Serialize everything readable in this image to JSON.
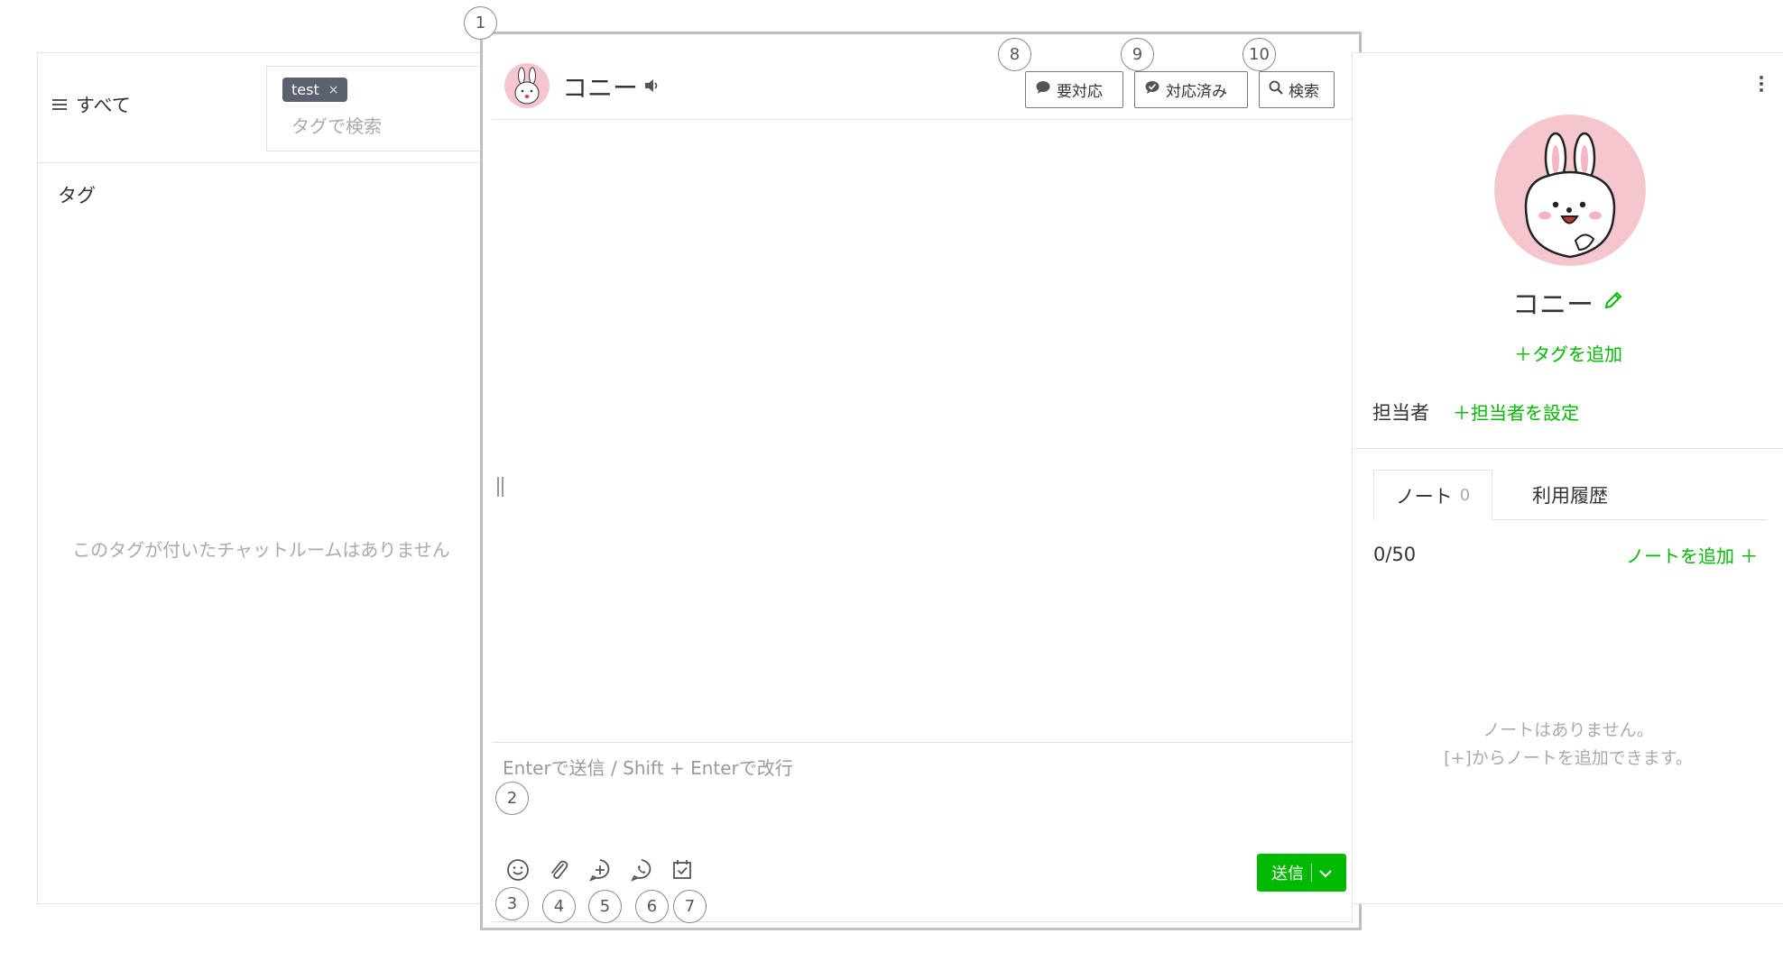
{
  "left_panel": {
    "filter_label": "すべて",
    "tag_chip": "test",
    "tag_chip_remove": "×",
    "tag_search_placeholder": "タグで検索",
    "tag_heading": "タグ",
    "empty_message": "このタグが付いたチャットルームはありません"
  },
  "chat": {
    "contact_name": "コニー",
    "buttons": {
      "needs_action": "要対応",
      "resolved": "対応済み",
      "search": "検索"
    },
    "input_placeholder": "Enterで送信 / Shift + Enterで改行",
    "send_label": "送信",
    "tools": [
      "smile-icon",
      "paperclip-icon",
      "plus-circle-icon",
      "phone-bubble-icon",
      "calendar-check-icon"
    ]
  },
  "callouts": [
    "1",
    "2",
    "3",
    "4",
    "5",
    "6",
    "7",
    "8",
    "9",
    "10"
  ],
  "profile": {
    "name": "コニー",
    "add_tag": "＋タグを追加",
    "assignee_label": "担当者",
    "assignee_link": "＋担当者を設定",
    "tabs": {
      "notes_label": "ノート",
      "notes_count": "0",
      "history_label": "利用履歴"
    },
    "note_count": "0/50",
    "add_note": "ノートを追加 ＋",
    "no_notes_line1": "ノートはありません。",
    "no_notes_line2": "[+]からノートを追加できます。"
  },
  "colors": {
    "accent_green": "#00b900",
    "tag_chip": "#5c6170",
    "avatar_pink": "#f6c6cf"
  }
}
